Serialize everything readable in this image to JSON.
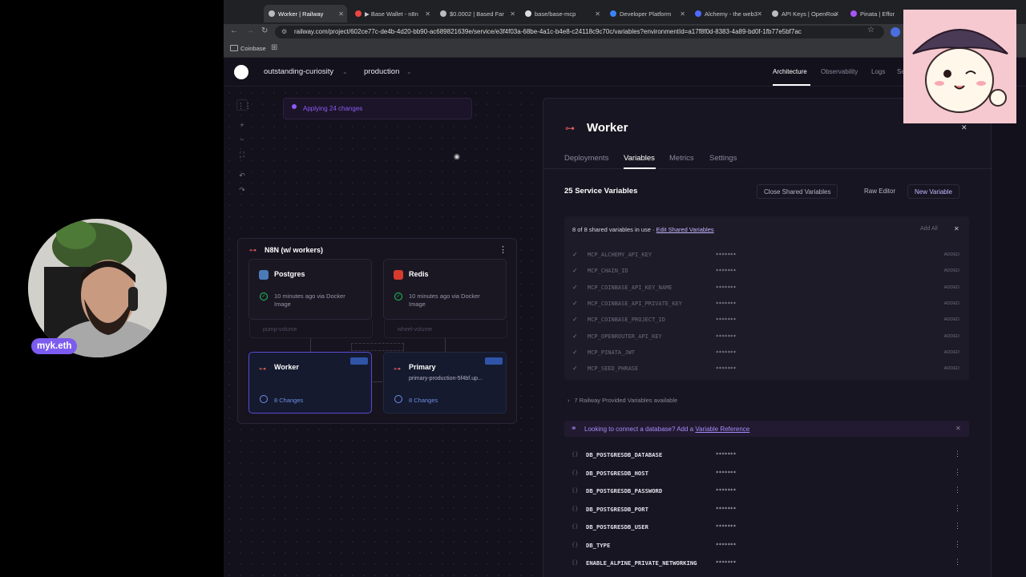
{
  "browser": {
    "tabs": [
      {
        "title": "Worker | Railway",
        "active": true
      },
      {
        "title": "▶ Base Wallet - n8n"
      },
      {
        "title": "$0.0002 | Based Far"
      },
      {
        "title": "base/base-mcp"
      },
      {
        "title": "Developer Platform"
      },
      {
        "title": "Alchemy - the web3"
      },
      {
        "title": "API Keys | OpenRou"
      },
      {
        "title": "Pinata | Effor"
      }
    ],
    "url": "railway.com/project/602ce77c-de4b-4d20-bb90-ac689821639e/service/e3f4f03a-68be-4a1c-b4e8-c24118c9c70c/variables?environmentId=a17f8f0d-8383-4a89-bd0f-1fb77e5bf7ac",
    "bookmark": "Coinbase"
  },
  "app": {
    "project_name": "outstanding-curiosity",
    "environment": "production",
    "nav": [
      "Architecture",
      "Observability",
      "Logs",
      "Se"
    ]
  },
  "canvas": {
    "applying": "Applying 24 changes",
    "project_group": "N8N (w/ workers)",
    "services": [
      {
        "name": "Postgres",
        "status": "10 minutes ago via Docker Image",
        "volume": "pump-volume"
      },
      {
        "name": "Redis",
        "status": "10 minutes ago via Docker Image",
        "volume": "wheel-volume"
      },
      {
        "name": "Worker",
        "changes": "8 Changes"
      },
      {
        "name": "Primary",
        "subtitle": "primary-production-5f4bf.up...",
        "changes": "8 Changes"
      }
    ]
  },
  "panel": {
    "title": "Worker",
    "tabs": [
      "Deployments",
      "Variables",
      "Metrics",
      "Settings"
    ],
    "active_tab": "Variables",
    "count_label": "25 Service Variables",
    "buttons": {
      "close_shared": "Close Shared Variables",
      "raw_editor": "Raw Editor",
      "new_variable": "New Variable"
    },
    "shared": {
      "summary": "8 of 8 shared variables in use · ",
      "edit_link": "Edit Shared Variables",
      "add_all": "Add All",
      "masked": "*******",
      "status": "ADDED",
      "items": [
        "MCP_ALCHEMY_API_KEY",
        "MCP_CHAIN_ID",
        "MCP_COINBASE_API_KEY_NAME",
        "MCP_COINBASE_API_PRIVATE_KEY",
        "MCP_COINBASE_PROJECT_ID",
        "MCP_OPENROUTER_API_KEY",
        "MCP_PINATA_JWT",
        "MCP_SEED_PHRASE"
      ]
    },
    "provided": "7 Railway Provided Variables available",
    "connect": {
      "text": "Looking to connect a database? Add a ",
      "link": "Variable Reference"
    },
    "variables": [
      "DB_POSTGRESDB_DATABASE",
      "DB_POSTGRESDB_HOST",
      "DB_POSTGRESDB_PASSWORD",
      "DB_POSTGRESDB_PORT",
      "DB_POSTGRESDB_USER",
      "DB_TYPE",
      "ENABLE_ALPINE_PRIVATE_NETWORKING"
    ]
  },
  "stream": {
    "handle": "myk.eth"
  }
}
